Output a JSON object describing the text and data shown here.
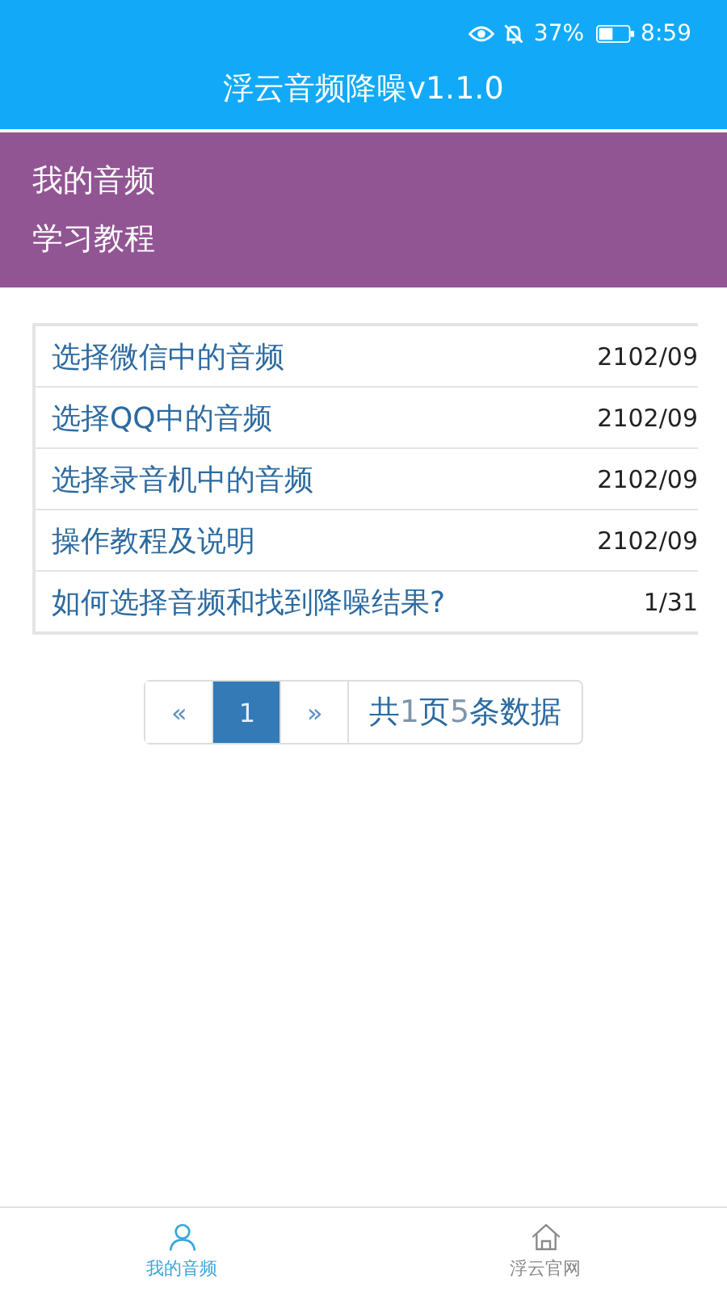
{
  "status_bar": {
    "battery": "37%",
    "time": "8:59"
  },
  "app_bar": {
    "title": "浮云音频降噪v1.1.0"
  },
  "menu": [
    {
      "label": "我的音频"
    },
    {
      "label": "学习教程"
    }
  ],
  "table": {
    "rows": [
      {
        "title": "选择微信中的音频",
        "date": "2102/09"
      },
      {
        "title": "选择QQ中的音频",
        "date": "2102/09"
      },
      {
        "title": "选择录音机中的音频",
        "date": "2102/09"
      },
      {
        "title": "操作教程及说明",
        "date": "2102/09"
      },
      {
        "title": "如何选择音频和找到降噪结果?",
        "date": "1/31"
      }
    ]
  },
  "pager": {
    "prev": "«",
    "pages": [
      {
        "label": "1",
        "selected": true
      }
    ],
    "next": "»",
    "summary": [
      {
        "text": "共",
        "muted": false
      },
      {
        "text": "1",
        "muted": true
      },
      {
        "text": "页 ",
        "muted": false
      },
      {
        "text": "5",
        "muted": true
      },
      {
        "text": "条数据",
        "muted": false
      }
    ]
  },
  "tabs": [
    {
      "label": "我的音频",
      "kind": "person",
      "selected": true
    },
    {
      "label": "浮云官网",
      "kind": "home",
      "selected": false
    }
  ]
}
